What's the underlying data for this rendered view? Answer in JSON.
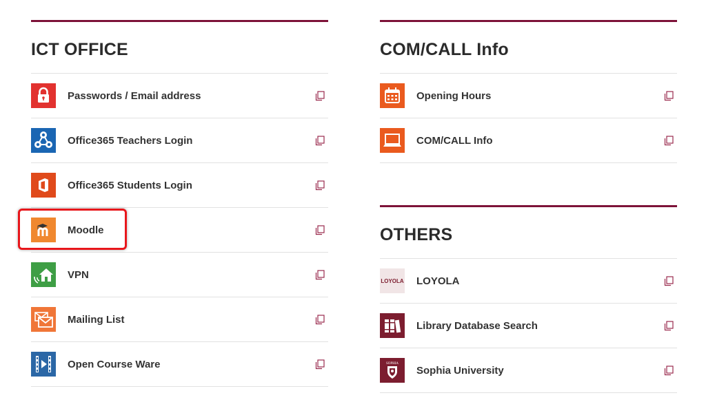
{
  "ict": {
    "title": "ICT OFFICE",
    "items": [
      {
        "label": "Passwords / Email address",
        "icon": "lock-icon"
      },
      {
        "label": "Office365 Teachers Login",
        "icon": "network-icon"
      },
      {
        "label": "Office365 Students Login",
        "icon": "office365-icon"
      },
      {
        "label": "Moodle",
        "icon": "moodle-icon"
      },
      {
        "label": "VPN",
        "icon": "home-signal-icon"
      },
      {
        "label": "Mailing List",
        "icon": "envelopes-icon"
      },
      {
        "label": "Open Course Ware",
        "icon": "video-icon"
      }
    ]
  },
  "comcall": {
    "title": "COM/CALL Info",
    "items": [
      {
        "label": "Opening Hours",
        "icon": "calendar-icon"
      },
      {
        "label": "COM/CALL Info",
        "icon": "computer-icon"
      }
    ]
  },
  "others": {
    "title": "OTHERS",
    "items": [
      {
        "label": "LOYOLA",
        "icon": "loyola-logo",
        "logo_text": "LOYOLA"
      },
      {
        "label": "Library Database Search",
        "icon": "books-icon"
      },
      {
        "label": "Sophia University",
        "icon": "sophia-crest-icon",
        "logo_text": "SOPHIA"
      }
    ]
  },
  "colors": {
    "accent_bar": "#7d1238",
    "copy_icon": "#9a2a4e",
    "highlight": "#e8161b"
  }
}
